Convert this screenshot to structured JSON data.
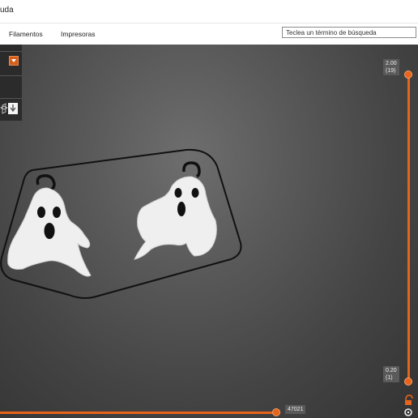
{
  "menubar": {
    "title_fragment": "uda"
  },
  "toolbar": {
    "tab_filaments": "Filamentos",
    "tab_printers": "Impresoras",
    "search_placeholder": "Teclea un término de búsqueda"
  },
  "layer_slider": {
    "top_value": "2.00",
    "top_layer": "(19)",
    "bottom_value": "0.20",
    "bottom_layer": "(1)"
  },
  "move_slider": {
    "value": "47021"
  },
  "colors": {
    "accent": "#e8641a",
    "ghost_fill": "#f2f2f2",
    "eye": "#111111"
  }
}
